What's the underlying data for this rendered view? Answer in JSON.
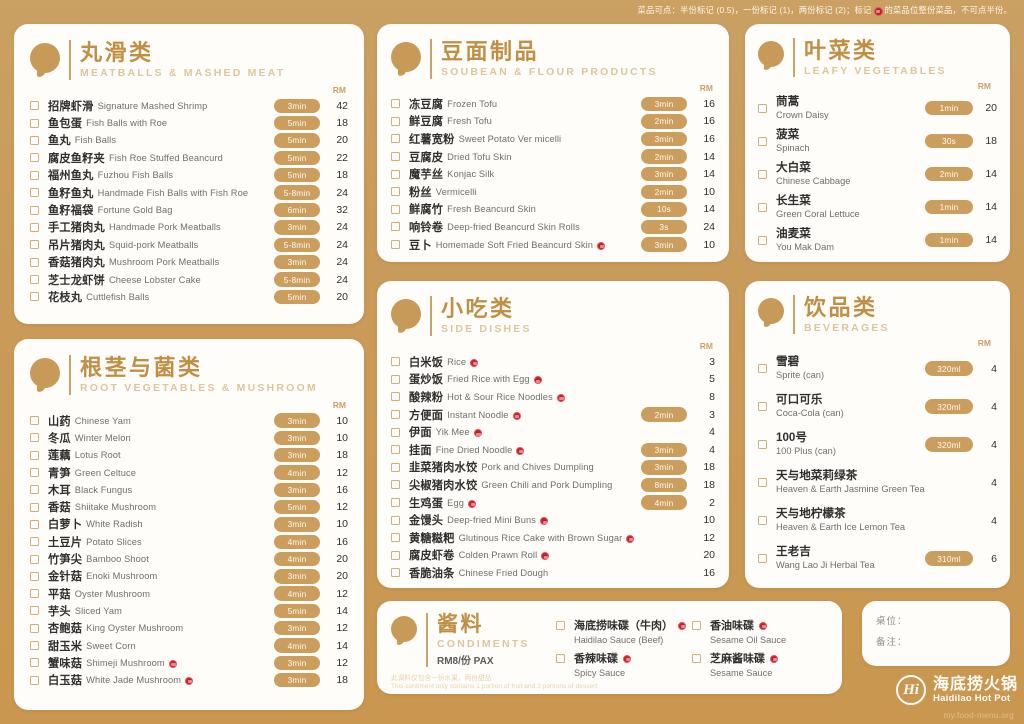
{
  "notice": {
    "text_before": "菜品可点：半份标记 (0.5)，一份标记 (1)，两份标记 (2)；标记",
    "text_after": "的菜品位整份菜品，不可点半份。"
  },
  "colors": {
    "background": "#c99a58",
    "card": "#fffdfa",
    "title_cn": "#c08f44",
    "title_en": "#dcc69a",
    "pill": "#cb9e5e",
    "badge_red": "#c0202c",
    "checkbox_border": "#d3ae76"
  },
  "price_unit": "RM",
  "sections": {
    "meatballs": {
      "title_cn": "丸滑类",
      "title_en": "MEATBALLS & MASHED MEAT",
      "unit": "RM",
      "items": [
        {
          "cn": "招牌虾滑",
          "en": "Signature Mashed Shrimp",
          "time": "3min",
          "price": "42",
          "whole": false
        },
        {
          "cn": "鱼包蛋",
          "en": "Fish Balls with Roe",
          "time": "5min",
          "price": "18",
          "whole": false
        },
        {
          "cn": "鱼丸",
          "en": "Fish Balls",
          "time": "5min",
          "price": "20",
          "whole": false
        },
        {
          "cn": "腐皮鱼籽夹",
          "en": "Fish Roe Stuffed Beancurd",
          "time": "5min",
          "price": "22",
          "whole": false
        },
        {
          "cn": "福州鱼丸",
          "en": "Fuzhou Fish Balls",
          "time": "5min",
          "price": "18",
          "whole": false
        },
        {
          "cn": "鱼籽鱼丸",
          "en": "Handmade Fish Balls with Fish Roe",
          "time": "5-8min",
          "price": "24",
          "whole": false
        },
        {
          "cn": "鱼籽福袋",
          "en": "Fortune Gold Bag",
          "time": "6min",
          "price": "32",
          "whole": false
        },
        {
          "cn": "手工猪肉丸",
          "en": "Handmade Pork Meatballs",
          "time": "3min",
          "price": "24",
          "whole": false
        },
        {
          "cn": "吊片猪肉丸",
          "en": "Squid-pork Meatballs",
          "time": "5-8min",
          "price": "24",
          "whole": false
        },
        {
          "cn": "香菇猪肉丸",
          "en": "Mushroom Pork Meatballs",
          "time": "3min",
          "price": "24",
          "whole": false
        },
        {
          "cn": "芝士龙虾饼",
          "en": "Cheese Lobster Cake",
          "time": "5-8min",
          "price": "24",
          "whole": false
        },
        {
          "cn": "花枝丸",
          "en": "Cuttlefish Balls",
          "time": "5min",
          "price": "20",
          "whole": false
        }
      ]
    },
    "root_vegetables": {
      "title_cn": "根茎与菌类",
      "title_en": "ROOT VEGETABLES & MUSHROOM",
      "unit": "RM",
      "items": [
        {
          "cn": "山药",
          "en": "Chinese Yam",
          "time": "3min",
          "price": "10",
          "whole": false
        },
        {
          "cn": "冬瓜",
          "en": "Winter Melon",
          "time": "3min",
          "price": "10",
          "whole": false
        },
        {
          "cn": "莲藕",
          "en": "Lotus Root",
          "time": "3min",
          "price": "18",
          "whole": false
        },
        {
          "cn": "青笋",
          "en": "Green Celtuce",
          "time": "4min",
          "price": "12",
          "whole": false
        },
        {
          "cn": "木耳",
          "en": "Black Fungus",
          "time": "3min",
          "price": "16",
          "whole": false
        },
        {
          "cn": "香菇",
          "en": "Shiitake Mushroom",
          "time": "5min",
          "price": "12",
          "whole": false
        },
        {
          "cn": "白萝卜",
          "en": "White Radish",
          "time": "3min",
          "price": "10",
          "whole": false
        },
        {
          "cn": "土豆片",
          "en": "Potato Slices",
          "time": "4min",
          "price": "16",
          "whole": false
        },
        {
          "cn": "竹笋尖",
          "en": "Bamboo Shoot",
          "time": "4min",
          "price": "20",
          "whole": false
        },
        {
          "cn": "金针菇",
          "en": "Enoki Mushroom",
          "time": "3min",
          "price": "20",
          "whole": false
        },
        {
          "cn": "平菇",
          "en": "Oyster Mushroom",
          "time": "4min",
          "price": "12",
          "whole": false
        },
        {
          "cn": "芋头",
          "en": "Sliced Yam",
          "time": "5min",
          "price": "14",
          "whole": false
        },
        {
          "cn": "杏鲍菇",
          "en": "King Oyster Mushroom",
          "time": "3min",
          "price": "12",
          "whole": false
        },
        {
          "cn": "甜玉米",
          "en": "Sweet Corn",
          "time": "4min",
          "price": "14",
          "whole": false
        },
        {
          "cn": "蟹味菇",
          "en": "Shimeji Mushroom",
          "time": "3min",
          "price": "12",
          "whole": true
        },
        {
          "cn": "白玉菇",
          "en": "White Jade Mushroom",
          "time": "3min",
          "price": "18",
          "whole": true
        }
      ]
    },
    "soubean": {
      "title_cn": "豆面制品",
      "title_en": "SOUBEAN & FLOUR PRODUCTS",
      "unit": "RM",
      "items": [
        {
          "cn": "冻豆腐",
          "en": "Frozen Tofu",
          "time": "3min",
          "price": "16",
          "whole": false
        },
        {
          "cn": "鲜豆腐",
          "en": "Fresh Tofu",
          "time": "2min",
          "price": "16",
          "whole": false
        },
        {
          "cn": "红薯宽粉",
          "en": "Sweet Potato Ver micelli",
          "time": "3min",
          "price": "16",
          "whole": false
        },
        {
          "cn": "豆腐皮",
          "en": "Dried Tofu Skin",
          "time": "2min",
          "price": "14",
          "whole": false
        },
        {
          "cn": "魔芋丝",
          "en": "Konjac Silk",
          "time": "3min",
          "price": "14",
          "whole": false
        },
        {
          "cn": "粉丝",
          "en": "Vermicelli",
          "time": "2min",
          "price": "10",
          "whole": false
        },
        {
          "cn": "鲜腐竹",
          "en": "Fresh Beancurd Skin",
          "time": "10s",
          "price": "14",
          "whole": false
        },
        {
          "cn": "响铃卷",
          "en": "Deep-fried Beancurd Skin Rolls",
          "time": "3s",
          "price": "24",
          "whole": false
        },
        {
          "cn": "豆卜",
          "en": "Homemade Soft Fried Beancurd Skin",
          "time": "3min",
          "price": "10",
          "whole": true
        }
      ]
    },
    "side_dishes": {
      "title_cn": "小吃类",
      "title_en": "SIDE DISHES",
      "unit": "RM",
      "items": [
        {
          "cn": "白米饭",
          "en": "Rice",
          "time": "",
          "price": "3",
          "whole": true
        },
        {
          "cn": "蛋炒饭",
          "en": "Fried Rice with Egg",
          "time": "",
          "price": "5",
          "whole": true
        },
        {
          "cn": "酸辣粉",
          "en": "Hot & Sour Rice Noodles",
          "time": "",
          "price": "8",
          "whole": true
        },
        {
          "cn": "方便面",
          "en": "Instant Noodle",
          "time": "2min",
          "price": "3",
          "whole": true
        },
        {
          "cn": "伊面",
          "en": "Yik Mee",
          "time": "",
          "price": "4",
          "whole": true
        },
        {
          "cn": "挂面",
          "en": "Fine Dried Noodle",
          "time": "3min",
          "price": "4",
          "whole": true
        },
        {
          "cn": "韭菜猪肉水饺",
          "en": "Pork and Chives Dumpling",
          "time": "3min",
          "price": "18",
          "whole": false
        },
        {
          "cn": "尖椒猪肉水饺",
          "en": "Green Chili and Pork Dumpling",
          "time": "8min",
          "price": "18",
          "whole": false
        },
        {
          "cn": "生鸡蛋",
          "en": "Egg",
          "time": "4min",
          "price": "2",
          "whole": true
        },
        {
          "cn": "金馒头",
          "en": "Deep-fried Mini Buns",
          "time": "",
          "price": "10",
          "whole": true
        },
        {
          "cn": "黄糖糍粑",
          "en": "Glutinous Rice Cake with Brown Sugar",
          "time": "",
          "price": "12",
          "whole": true
        },
        {
          "cn": "腐皮虾卷",
          "en": "Colden Prawn Roll",
          "time": "",
          "price": "20",
          "whole": true
        },
        {
          "cn": "香脆油条",
          "en": "Chinese Fried Dough",
          "time": "",
          "price": "16",
          "whole": false
        }
      ]
    },
    "leafy": {
      "title_cn": "叶菜类",
      "title_en": "LEAFY VEGETABLES",
      "unit": "RM",
      "items": [
        {
          "cn": "茼蒿",
          "en": "Crown Daisy",
          "time": "1min",
          "price": "20"
        },
        {
          "cn": "菠菜",
          "en": "Spinach",
          "time": "30s",
          "price": "18"
        },
        {
          "cn": "大白菜",
          "en": "Chinese Cabbage",
          "time": "2min",
          "price": "14"
        },
        {
          "cn": "长生菜",
          "en": "Green Coral Lettuce",
          "time": "1min",
          "price": "14"
        },
        {
          "cn": "油麦菜",
          "en": "You Mak Dam",
          "time": "1min",
          "price": "14"
        }
      ]
    },
    "beverages": {
      "title_cn": "饮品类",
      "title_en": "BEVERAGES",
      "unit": "RM",
      "items": [
        {
          "cn": "雪碧",
          "en": "Sprite (can)",
          "time": "320ml",
          "price": "4"
        },
        {
          "cn": "可口可乐",
          "en": "Coca-Cola (can)",
          "time": "320ml",
          "price": "4"
        },
        {
          "cn": "100号",
          "en": "100 Plus (can)",
          "time": "320ml",
          "price": "4"
        },
        {
          "cn": "天与地菜莉绿茶",
          "en": "Heaven & Earth Jasmine Green Tea",
          "time": "",
          "price": "4"
        },
        {
          "cn": "天与地柠檬茶",
          "en": "Heaven & Earth Ice Lemon Tea",
          "time": "",
          "price": "4"
        },
        {
          "cn": "王老吉",
          "en": "Wang Lao Ji Herbal Tea",
          "time": "310ml",
          "price": "6"
        }
      ]
    },
    "condiments": {
      "title_cn": "酱料",
      "title_en": "CONDIMENTS",
      "price_label": "RM8/份 PAX",
      "note_cn": "此调料仅包含一份水果，两份甜品",
      "note_en": "This contiment only contains 1 portion of fruit and 2 portions of dessert",
      "items": [
        {
          "cn": "海底捞味碟（牛肉）",
          "en": "Haidilao Sauce (Beef)",
          "whole": true
        },
        {
          "cn": "香油味碟",
          "en": "Sesame Oil Sauce",
          "whole": true
        },
        {
          "cn": "香辣味碟",
          "en": "Spicy Sauce",
          "whole": true
        },
        {
          "cn": "芝麻酱味碟",
          "en": "Sesame Sauce",
          "whole": true
        }
      ]
    }
  },
  "table_note": {
    "seat_label": "桌位：",
    "remark_label": "备注："
  },
  "brand": {
    "mark": "Hi",
    "name_cn": "海底捞火锅",
    "name_en": "Haidilao Hot Pot",
    "watermark": "my.food-menu.org"
  }
}
